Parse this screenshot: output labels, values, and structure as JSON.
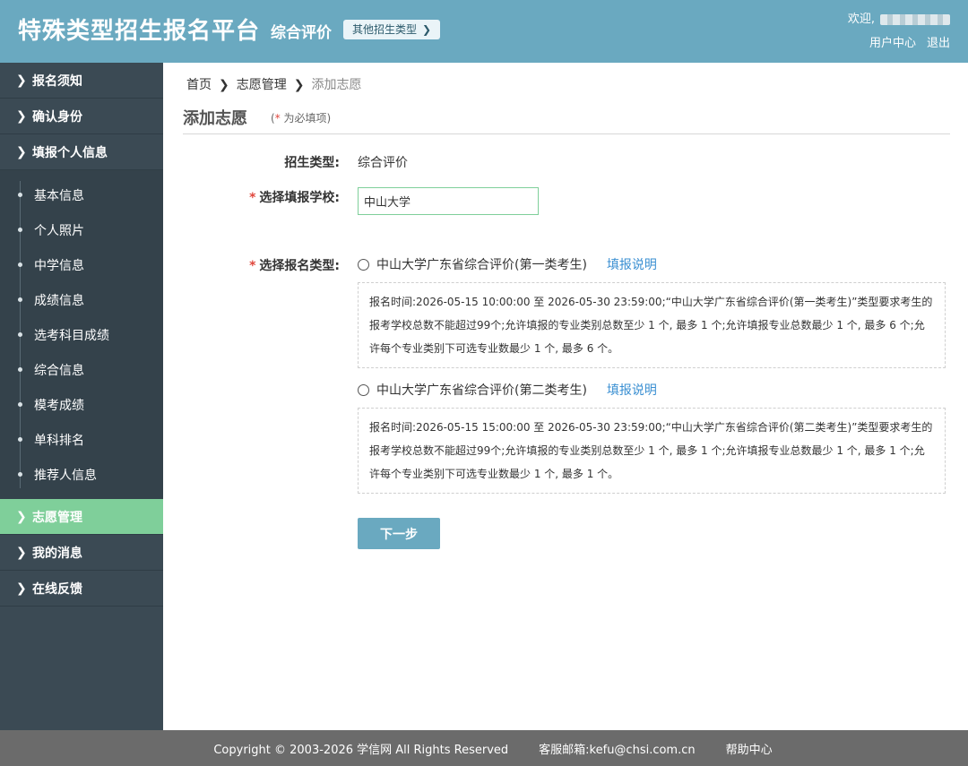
{
  "header": {
    "brand": "特殊类型招生报名平台",
    "subtitle": "综合评价",
    "other_types": "其他招生类型",
    "welcome": "欢迎,",
    "user_center": "用户中心",
    "logout": "退出"
  },
  "sidebar": {
    "top_items": [
      {
        "label": "报名须知"
      },
      {
        "label": "确认身份"
      },
      {
        "label": "填报个人信息"
      }
    ],
    "sub_items": [
      {
        "label": "基本信息"
      },
      {
        "label": "个人照片"
      },
      {
        "label": "中学信息"
      },
      {
        "label": "成绩信息"
      },
      {
        "label": "选考科目成绩"
      },
      {
        "label": "综合信息"
      },
      {
        "label": "模考成绩"
      },
      {
        "label": "单科排名"
      },
      {
        "label": "推荐人信息"
      }
    ],
    "bottom_items": [
      {
        "label": "志愿管理",
        "active": true
      },
      {
        "label": "我的消息"
      },
      {
        "label": "在线反馈"
      }
    ]
  },
  "breadcrumb": {
    "home": "首页",
    "section": "志愿管理",
    "current": "添加志愿"
  },
  "page": {
    "title": "添加志愿",
    "required_open": "(",
    "required_star": "*",
    "required_text": " 为必填项)"
  },
  "form": {
    "type_label": "招生类型:",
    "type_value": "综合评价",
    "school_label": "选择填报学校:",
    "school_value": "中山大学",
    "category_label": "选择报名类型:",
    "star": "*",
    "options": [
      {
        "label": "中山大学广东省综合评价(第一类考生)",
        "help": "填报说明",
        "desc": "报名时间:2026-05-15 10:00:00 至 2026-05-30 23:59:00;“中山大学广东省综合评价(第一类考生)”类型要求考生的报考学校总数不能超过99个;允许填报的专业类别总数至少 1 个, 最多 1 个;允许填报专业总数最少 1 个, 最多 6 个;允许每个专业类别下可选专业数最少 1 个, 最多 6 个。"
      },
      {
        "label": "中山大学广东省综合评价(第二类考生)",
        "help": "填报说明",
        "desc": "报名时间:2026-05-15 15:00:00 至 2026-05-30 23:59:00;“中山大学广东省综合评价(第二类考生)”类型要求考生的报考学校总数不能超过99个;允许填报的专业类别总数至少 1 个, 最多 1 个;允许填报专业总数最少 1 个, 最多 1 个;允许每个专业类别下可选专业数最少 1 个, 最多 1 个。"
      }
    ],
    "next_button": "下一步"
  },
  "footer": {
    "copyright": "Copyright © 2003-2026 学信网 All Rights Reserved",
    "email": "客服邮箱:kefu@chsi.com.cn",
    "help": "帮助中心"
  }
}
